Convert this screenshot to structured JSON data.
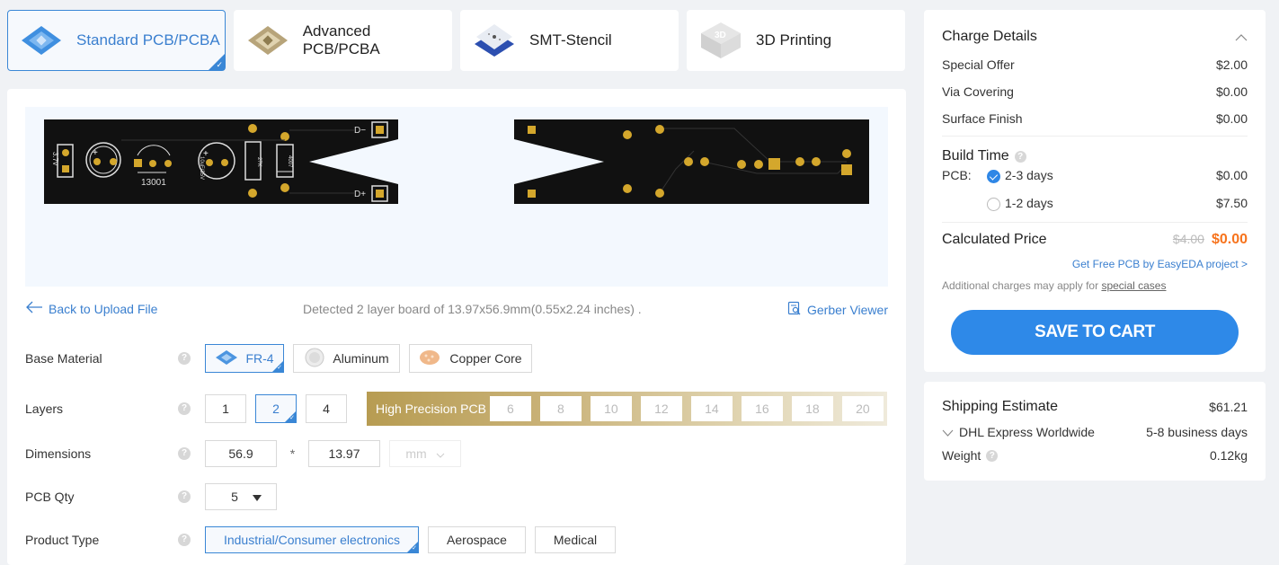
{
  "tabs": [
    {
      "label": "Standard PCB/PCBA",
      "icon": "standard-pcb-icon",
      "active": true
    },
    {
      "label": "Advanced PCB/PCBA",
      "icon": "advanced-pcb-icon",
      "active": false
    },
    {
      "label": "SMT-Stencil",
      "icon": "smt-stencil-icon",
      "active": false
    },
    {
      "label": "3D Printing",
      "icon": "3d-printing-icon",
      "active": false
    }
  ],
  "preview": {
    "top_labels": {
      "voltage": "3.7v",
      "transistor": "13001",
      "capacitor": "10uF/35V",
      "resistor1": "27K",
      "diode": "4007",
      "dminus": "D−",
      "dplus": "D+"
    }
  },
  "info": {
    "back_label": "Back to Upload File",
    "detected": "Detected 2 layer board of 13.97x56.9mm(0.55x2.24 inches) .",
    "gerber_label": "Gerber Viewer"
  },
  "form": {
    "base_material": {
      "label": "Base Material",
      "options": [
        "FR-4",
        "Aluminum",
        "Copper Core"
      ],
      "selected": "FR-4"
    },
    "layers": {
      "label": "Layers",
      "options": [
        "1",
        "2",
        "4"
      ],
      "selected": "2",
      "high_precision_label": "High Precision PCB",
      "high_precision_options": [
        "6",
        "8",
        "10",
        "12",
        "14",
        "16",
        "18",
        "20"
      ]
    },
    "dimensions": {
      "label": "Dimensions",
      "width": "56.9",
      "sep": "*",
      "height": "13.97",
      "unit": "mm"
    },
    "qty": {
      "label": "PCB Qty",
      "value": "5"
    },
    "product_type": {
      "label": "Product Type",
      "options": [
        "Industrial/Consumer electronics",
        "Aerospace",
        "Medical"
      ],
      "selected": "Industrial/Consumer electronics"
    },
    "help": "?"
  },
  "charges": {
    "title": "Charge Details",
    "items": [
      {
        "label": "Special Offer",
        "value": "$2.00"
      },
      {
        "label": "Via Covering",
        "value": "$0.00"
      },
      {
        "label": "Surface Finish",
        "value": "$0.00"
      }
    ],
    "build_time": {
      "title": "Build Time",
      "pcb_label": "PCB:",
      "options": [
        {
          "label": "2-3 days",
          "price": "$0.00",
          "selected": true
        },
        {
          "label": "1-2 days",
          "price": "$7.50",
          "selected": false
        }
      ]
    },
    "calculated": {
      "label": "Calculated Price",
      "old": "$4.00",
      "new": "$0.00"
    },
    "free_link": "Get Free PCB by EasyEDA project >",
    "note": "Additional charges may apply for ",
    "note_link": "special cases",
    "save_label": "SAVE TO CART"
  },
  "shipping": {
    "title": "Shipping Estimate",
    "price": "$61.21",
    "method": "DHL Express Worldwide",
    "time": "5-8 business days",
    "weight_label": "Weight",
    "weight": "0.12kg"
  },
  "colors": {
    "accent": "#2e89e8",
    "price": "#f7731c",
    "gold": "#b79c52"
  }
}
